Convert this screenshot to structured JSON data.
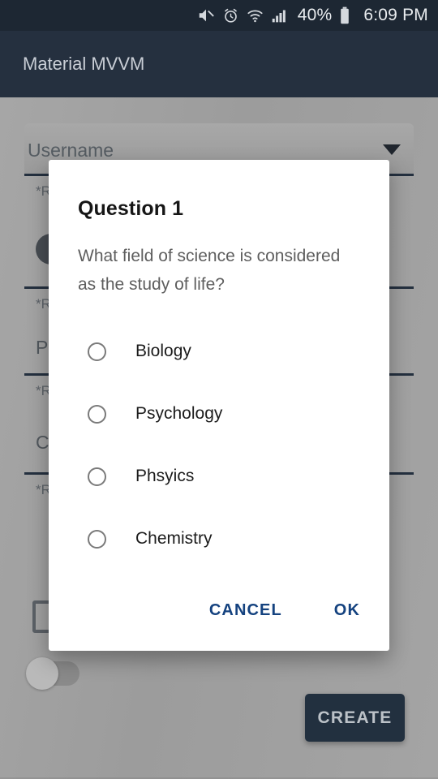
{
  "status_bar": {
    "icons": [
      "mute-icon",
      "alarm-icon",
      "wifi-icon",
      "signal-icon"
    ],
    "battery_percent": "40%",
    "battery_icon": "battery-icon",
    "clock": "6:09 PM"
  },
  "app_bar": {
    "title": "Material MVVM"
  },
  "background_form": {
    "username_field": {
      "label": "Username",
      "helper": "*Required",
      "caret_icon": "dropdown-caret-icon"
    },
    "password_field": {
      "label": "P",
      "helper": "*R"
    },
    "confirm_field": {
      "label": "C",
      "helper": "*R"
    },
    "avatar": "avatar-icon",
    "checkbox_label": "",
    "switch_label": "",
    "create_button": "CREATE"
  },
  "dialog": {
    "title": "Question 1",
    "message": "What field of science is considered as the study of life?",
    "options": [
      {
        "label": "Biology",
        "selected": false
      },
      {
        "label": "Psychology",
        "selected": false
      },
      {
        "label": "Phsyics",
        "selected": false
      },
      {
        "label": "Chemistry",
        "selected": false
      }
    ],
    "cancel_label": "CANCEL",
    "ok_label": "OK"
  },
  "colors": {
    "status_bar_bg": "#1d2733",
    "app_bar_bg": "#25303f",
    "scrim": "#a2a2a2",
    "dialog_bg": "#ffffff",
    "accent_blue": "#14427f",
    "create_button_bg": "#22303f",
    "radio_stroke": "#7a7a7a",
    "title_text": "#161616",
    "message_text": "#5e5e5e"
  }
}
